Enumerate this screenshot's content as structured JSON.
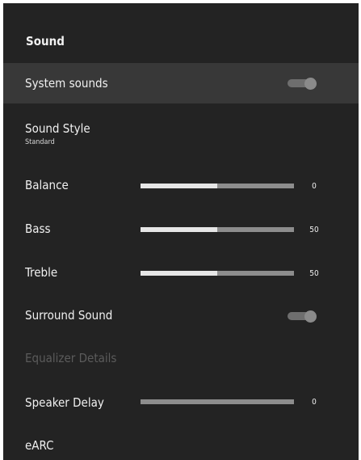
{
  "panel": {
    "title": "Sound"
  },
  "items": {
    "system_sounds": {
      "label": "System sounds",
      "toggle_on": true
    },
    "sound_style": {
      "label": "Sound Style",
      "sublabel": "Standard"
    },
    "balance": {
      "label": "Balance",
      "value": "0",
      "fill_fraction": 0.5
    },
    "bass": {
      "label": "Bass",
      "value": "50",
      "fill_fraction": 0.5
    },
    "treble": {
      "label": "Treble",
      "value": "50",
      "fill_fraction": 0.5
    },
    "surround_sound": {
      "label": "Surround Sound",
      "toggle_on": true
    },
    "equalizer_details": {
      "label": "Equalizer Details",
      "disabled": true
    },
    "speaker_delay": {
      "label": "Speaker Delay",
      "value": "0",
      "fill_fraction": 0
    },
    "earc": {
      "label": "eARC"
    }
  }
}
